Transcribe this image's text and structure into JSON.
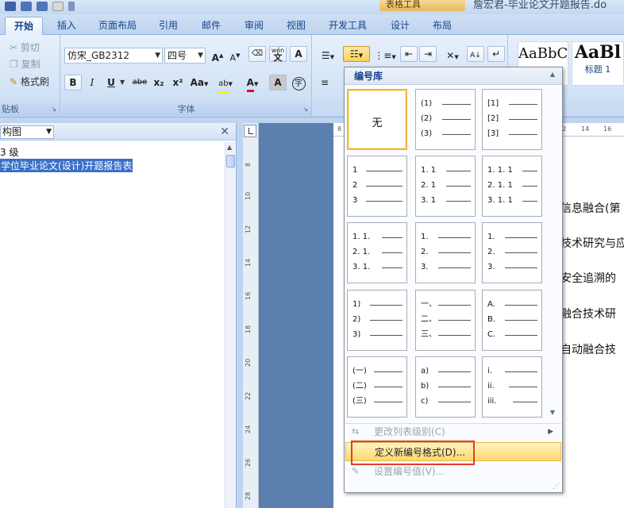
{
  "window": {
    "context_group": "表格工具",
    "doc_title": "詹宏君-毕业论文开题报告.do"
  },
  "tabs": [
    {
      "label": "开始",
      "active": true
    },
    {
      "label": "插入"
    },
    {
      "label": "页面布局"
    },
    {
      "label": "引用"
    },
    {
      "label": "邮件"
    },
    {
      "label": "审阅"
    },
    {
      "label": "视图"
    },
    {
      "label": "开发工具"
    },
    {
      "label": "设计"
    },
    {
      "label": "布局"
    }
  ],
  "clipboard": {
    "cut": "剪切",
    "copy": "复制",
    "format_painter": "格式刷",
    "group_label": "贴板"
  },
  "font": {
    "name": "仿宋_GB2312",
    "size": "四号",
    "group_label": "字体",
    "bold": "B",
    "italic": "I",
    "underline": "U",
    "strike": "abe",
    "subscript": "x₂",
    "superscript": "x²",
    "change_case": "Aa",
    "grow": "A",
    "shrink": "A",
    "phonetic": "wén",
    "text_effect": "A",
    "font_color": "A",
    "char_shading": "A",
    "enclose": "字"
  },
  "styles": [
    {
      "preview": "AaBbC",
      "name": ""
    },
    {
      "preview": "AaBl",
      "name": "标题 1"
    }
  ],
  "nav_pane": {
    "view": "构图",
    "level": "3 级",
    "selected_item": "学位毕业论文(设计)开题报告表"
  },
  "ruler": {
    "vertical_ticks": [
      "8",
      "10",
      "12",
      "14",
      "16",
      "18",
      "20",
      "22",
      "24",
      "26",
      "28"
    ],
    "horizontal_left": "8",
    "horizontal_right": [
      "2",
      "14",
      "16"
    ]
  },
  "document_lines": [
    "信息融合(第",
    "技术研究与应",
    "安全追溯的",
    "融合技术研",
    "自动融合技"
  ],
  "numbering_panel": {
    "title": "编号库",
    "tiles": [
      {
        "none_label": "无"
      },
      {
        "markers": [
          "(1)",
          "(2)",
          "(3)"
        ]
      },
      {
        "markers": [
          "[1]",
          "[2]",
          "[3]"
        ]
      },
      {
        "markers": [
          "1",
          "2",
          "3"
        ]
      },
      {
        "markers": [
          "1. 1",
          "2. 1",
          "3. 1"
        ]
      },
      {
        "markers": [
          "1. 1. 1",
          "2. 1. 1",
          "3. 1. 1"
        ]
      },
      {
        "markers": [
          "1. 1.",
          "2. 1.",
          "3. 1."
        ]
      },
      {
        "markers": [
          "1.",
          "2.",
          "3."
        ]
      },
      {
        "markers": [
          "1.",
          "2.",
          "3."
        ]
      },
      {
        "markers": [
          "1)",
          "2)",
          "3)"
        ]
      },
      {
        "markers": [
          "一、",
          "二、",
          "三、"
        ]
      },
      {
        "markers": [
          "A.",
          "B.",
          "C."
        ]
      },
      {
        "markers": [
          "(一)",
          "(二)",
          "(三)"
        ]
      },
      {
        "markers": [
          "a)",
          "b)",
          "c)"
        ]
      },
      {
        "markers": [
          "i.",
          "ii.",
          "iii."
        ]
      }
    ],
    "menu": {
      "change_level": "更改列表级别(C)",
      "define_new": "定义新编号格式(D)...",
      "set_value": "设置编号值(V)..."
    }
  },
  "colors": {
    "accent": "#15428b",
    "selection": "#3a6fc8",
    "highlight_box": "#e03c31",
    "hover": "#ffd96b"
  }
}
